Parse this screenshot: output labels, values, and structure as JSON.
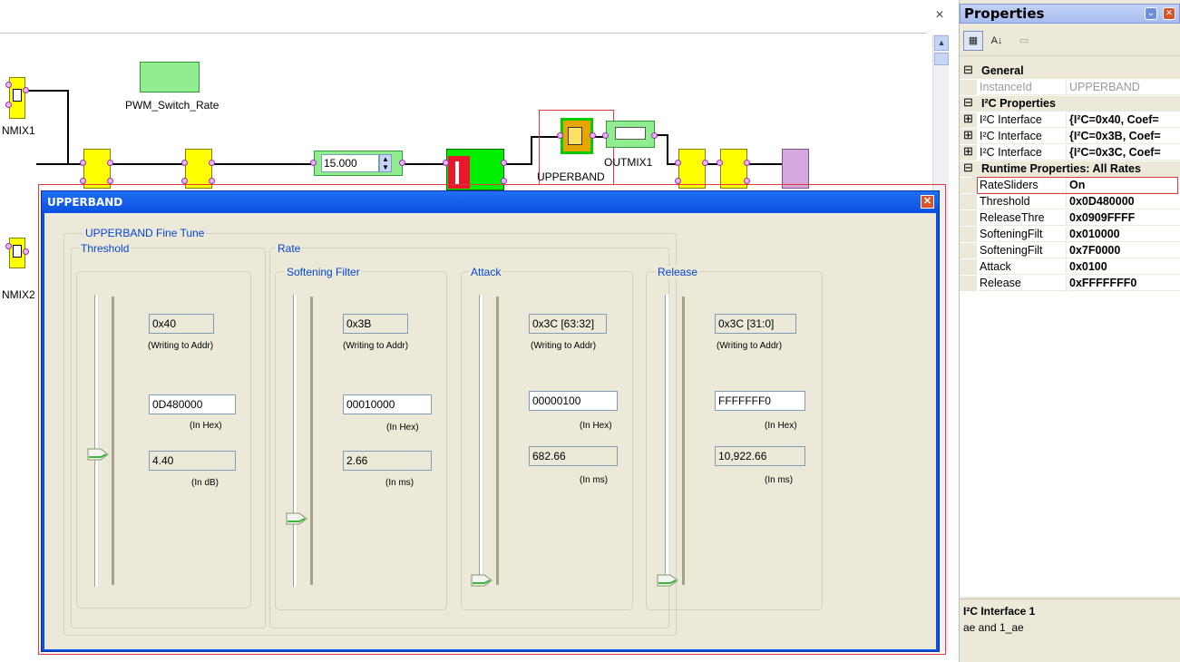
{
  "canvas": {
    "close_glyph": "×",
    "blocks": {
      "pwm_label": "PWM_Switch_Rate",
      "nmix1_label": "NMIX1",
      "nmix2_label": "NMIX2",
      "upperband_label": "UPPERBAND",
      "outmix1_label": "OUTMIX1",
      "spinner_value": "15.000"
    },
    "colors": {
      "block_yellow": "#ffff00",
      "block_green": "#00ee00",
      "block_lightgreen": "#90ee90",
      "highlight": "#e03a3a"
    }
  },
  "dialog": {
    "title": "UPPERBAND",
    "close_glyph": "✕",
    "fine_tune_label": "UPPERBAND Fine Tune",
    "threshold": {
      "label": "Threshold",
      "addr": "0x40",
      "addr_caption": "(Writing to Addr)",
      "hex": "0D480000",
      "hex_caption": "(In Hex)",
      "value": "4.40",
      "value_caption": "(In dB)"
    },
    "rate": {
      "label": "Rate",
      "softening": {
        "label": "Softening Filter",
        "addr": "0x3B",
        "addr_caption": "(Writing to Addr)",
        "hex": "00010000",
        "hex_caption": "(In Hex)",
        "value": "2.66",
        "value_caption": "(In ms)"
      },
      "attack": {
        "label": "Attack",
        "addr": "0x3C [63:32]",
        "addr_caption": "(Writing to Addr)",
        "hex": "00000100",
        "hex_caption": "(In Hex)",
        "value": "682.66",
        "value_caption": "(In ms)"
      },
      "release": {
        "label": "Release",
        "addr": "0x3C [31:0]",
        "addr_caption": "(Writing to Addr)",
        "hex": "FFFFFFF0",
        "hex_caption": "(In Hex)",
        "value": "10,922.66",
        "value_caption": "(In ms)"
      }
    },
    "slider_levels": {
      "threshold": 0.45,
      "softening": 0.22,
      "attack": 0.0,
      "release": 0.0
    }
  },
  "properties": {
    "title": "Properties",
    "sections": [
      {
        "kind": "cat",
        "expander": "⊟",
        "label": "General"
      },
      {
        "kind": "row",
        "name": "InstanceId",
        "value": "UPPERBAND",
        "disabled": true
      },
      {
        "kind": "cat",
        "expander": "⊟",
        "label": "I²C Properties"
      },
      {
        "kind": "row",
        "expander": "⊞",
        "name": "I²C Interface",
        "value": "{I²C=0x40, Coef="
      },
      {
        "kind": "row",
        "expander": "⊞",
        "name": "I²C Interface",
        "value": "{I²C=0x3B, Coef="
      },
      {
        "kind": "row",
        "expander": "⊞",
        "name": "I²C Interface",
        "value": "{I²C=0x3C, Coef="
      },
      {
        "kind": "cat",
        "expander": "⊟",
        "label": "Runtime Properties: All Rates"
      },
      {
        "kind": "row",
        "name": "RateSliders",
        "value": "On",
        "selected": true
      },
      {
        "kind": "row",
        "name": "Threshold",
        "value": "0x0D480000"
      },
      {
        "kind": "row",
        "name": "ReleaseThre",
        "value": "0x0909FFFF"
      },
      {
        "kind": "row",
        "name": "SofteningFilt",
        "value": "0x010000"
      },
      {
        "kind": "row",
        "name": "SofteningFilt",
        "value": "0x7F0000"
      },
      {
        "kind": "row",
        "name": "Attack",
        "value": "0x0100"
      },
      {
        "kind": "row",
        "name": "Release",
        "value": "0xFFFFFFF0"
      }
    ],
    "description_title": "I²C Interface 1",
    "description_text": "ae and 1_ae"
  }
}
